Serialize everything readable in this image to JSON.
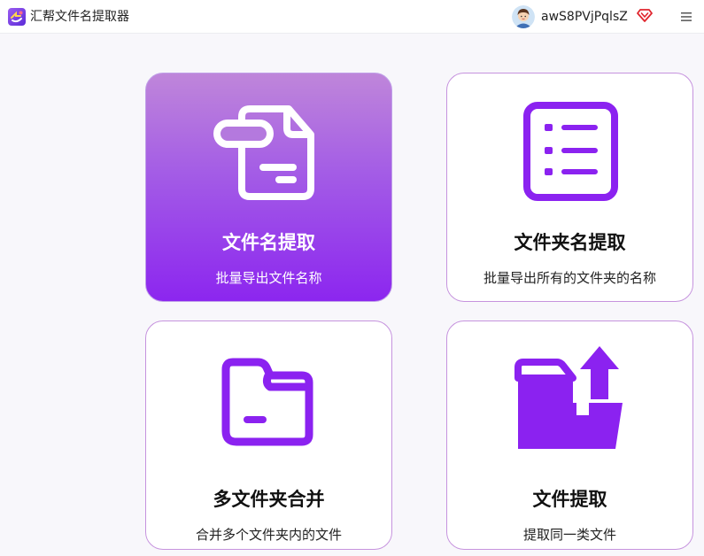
{
  "app": {
    "title": "汇帮文件名提取器",
    "username": "awS8PVjPqlsZ",
    "icons": {
      "logo": "app-logo-icon",
      "avatar": "avatar",
      "vip": "vip-diamond-icon",
      "menu": "hamburger-menu-icon"
    },
    "colors": {
      "accent": "#8b22f0",
      "card_border": "#c693de",
      "vip": "#e0262e"
    }
  },
  "cards": [
    {
      "title": "文件名提取",
      "desc": "批量导出文件名称",
      "icon": "file-document-icon",
      "active": true
    },
    {
      "title": "文件夹名提取",
      "desc": "批量导出所有的文件夹的名称",
      "icon": "list-icon",
      "active": false
    },
    {
      "title": "多文件夹合并",
      "desc": "合并多个文件夹内的文件",
      "icon": "folder-icon",
      "active": false
    },
    {
      "title": "文件提取",
      "desc": "提取同一类文件",
      "icon": "folder-upload-icon",
      "active": false
    }
  ]
}
